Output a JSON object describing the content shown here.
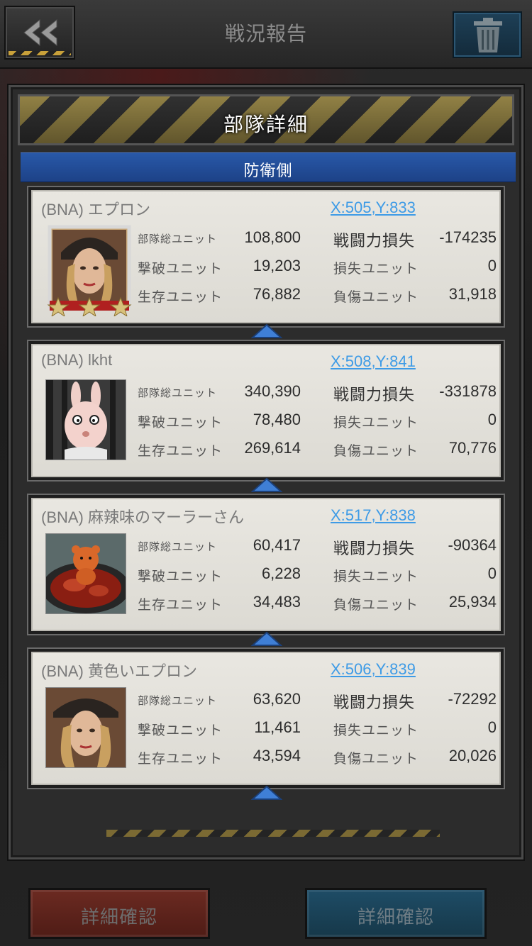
{
  "header": {
    "title": "戦況報告"
  },
  "panel": {
    "title": "部隊詳細",
    "side_label": "防衛側"
  },
  "labels": {
    "total_units": "部隊総ユニット",
    "destroyed_units": "撃破ユニット",
    "surviving_units": "生存ユニット",
    "power_loss": "戦闘力損失",
    "lost_units": "損失ユニット",
    "wounded_units": "負傷ユニット"
  },
  "cards": [
    {
      "name": "(BNA) エプロン",
      "coord": "X:505,Y:833",
      "total": "108,800",
      "destroyed": "19,203",
      "surviving": "76,882",
      "power_loss": "-174235",
      "lost": "0",
      "wounded": "31,918"
    },
    {
      "name": "(BNA) lkht",
      "coord": "X:508,Y:841",
      "total": "340,390",
      "destroyed": "78,480",
      "surviving": "269,614",
      "power_loss": "-331878",
      "lost": "0",
      "wounded": "70,776"
    },
    {
      "name": "(BNA) 麻辣味のマーラーさん",
      "coord": "X:517,Y:838",
      "total": "60,417",
      "destroyed": "6,228",
      "surviving": "34,483",
      "power_loss": "-90364",
      "lost": "0",
      "wounded": "25,934"
    },
    {
      "name": "(BNA) 黄色いエプロン",
      "coord": "X:506,Y:839",
      "total": "63,620",
      "destroyed": "11,461",
      "surviving": "43,594",
      "power_loss": "-72292",
      "lost": "0",
      "wounded": "20,026"
    }
  ],
  "buttons": {
    "left_label": "詳細確認",
    "right_label": "詳細確認"
  },
  "icons": {
    "back": "double-chevron-left-icon",
    "trash": "trash-icon",
    "expand": "chevron-up-icon"
  },
  "colors": {
    "side_bar": "#2858a8",
    "coord_link": "#3e9be6",
    "left_button": "#6b2a21",
    "right_button": "#1e4c66",
    "hazard_yellow": "#bfa64a"
  }
}
